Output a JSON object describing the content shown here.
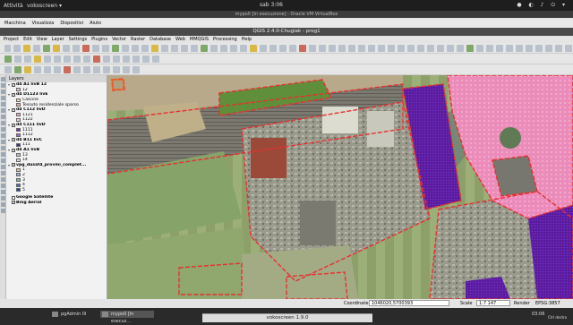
{
  "top_bar": {
    "activities": "Attività",
    "app": "vokoscreen ▾",
    "clock": "sab 3:06",
    "tray": "● ◐ ♪ ⏻ ▾"
  },
  "vbox": {
    "title": "mypo0 [In esecuzione] - Oracle VM VirtualBox",
    "menu": [
      "Macchina",
      "Visualizza",
      "Dispositivi",
      "Aiuto"
    ]
  },
  "qgis": {
    "title": "QGIS 2.4.0-Chugiak - prog1",
    "menu": [
      "Project",
      "Edit",
      "View",
      "Layer",
      "Settings",
      "Plugins",
      "Vector",
      "Raster",
      "Database",
      "Web",
      "MMQGIS",
      "Processing",
      "Help"
    ]
  },
  "layers_panel": {
    "title": "Layers",
    "items": [
      {
        "label": "d4 A1 livB 12",
        "bold": true,
        "indent": 0,
        "checked": true,
        "twisty": "▾"
      },
      {
        "label": "12",
        "bold": false,
        "indent": 1,
        "swatch": "#e8c9c0"
      },
      {
        "label": "d4 D1123 livE",
        "bold": true,
        "indent": 0,
        "checked": true,
        "twisty": "▾"
      },
      {
        "label": "Cascine",
        "bold": false,
        "indent": 1,
        "swatch": "#f2d9a0"
      },
      {
        "label": "Tessuto residenziale sparso",
        "bold": false,
        "indent": 1,
        "swatch": "#f0a8a0"
      },
      {
        "label": "d4 C112 livD",
        "bold": true,
        "indent": 0,
        "checked": true,
        "twisty": "▾"
      },
      {
        "label": "1121",
        "bold": false,
        "indent": 1,
        "swatch": "#f1a4c4"
      },
      {
        "label": "1122",
        "bold": false,
        "indent": 1,
        "swatch": "#f7c6da"
      },
      {
        "label": "d4 C111 livD",
        "bold": true,
        "indent": 0,
        "checked": true,
        "twisty": "▾"
      },
      {
        "label": "1111",
        "bold": false,
        "indent": 1,
        "swatch": "#7b2bb0"
      },
      {
        "label": "1112",
        "bold": false,
        "indent": 1,
        "swatch": "#a06ad0"
      },
      {
        "label": "d4 B11 livC",
        "bold": true,
        "indent": 0,
        "checked": true,
        "twisty": "▾"
      },
      {
        "label": "111",
        "bold": false,
        "indent": 1,
        "swatch": "#4a2a8a"
      },
      {
        "label": "d4 A1 livB",
        "bold": true,
        "indent": 0,
        "checked": true,
        "twisty": "▾"
      },
      {
        "label": "13",
        "bold": false,
        "indent": 1,
        "swatch": "#c0c0d0"
      },
      {
        "label": "14",
        "bold": false,
        "indent": 1,
        "swatch": "#d8d8d8"
      },
      {
        "label": "vpg_dusaf4_provmi_complet...",
        "bold": true,
        "indent": 0,
        "checked": true,
        "twisty": "▾"
      },
      {
        "label": "1",
        "bold": false,
        "indent": 1,
        "swatch": "#f0c080"
      },
      {
        "label": "2",
        "bold": false,
        "indent": 1,
        "swatch": "#90b0e0"
      },
      {
        "label": "3",
        "bold": false,
        "indent": 1,
        "swatch": "#70c0a0"
      },
      {
        "label": "4",
        "bold": false,
        "indent": 1,
        "swatch": "#4070c0"
      },
      {
        "label": "5",
        "bold": false,
        "indent": 1,
        "swatch": "#2040a0"
      },
      {
        "label": "",
        "bold": false,
        "indent": 0,
        "spacer": true
      },
      {
        "label": "Google Satellite",
        "bold": true,
        "indent": 0,
        "checked": false,
        "twisty": ""
      },
      {
        "label": "Bing Aerial",
        "bold": true,
        "indent": 0,
        "checked": true,
        "twisty": ""
      }
    ]
  },
  "status_bar": {
    "coordinate_label": "Coordinate:",
    "coordinate_value": "1046020,5700393",
    "scale_label": "Scale",
    "scale_value": "1:7 147",
    "render_label": "Render",
    "crs": "EPSG:3857"
  },
  "taskbar": {
    "items": [
      {
        "label": "pgAdmin III"
      },
      {
        "label": "mypo0 [In esecuz..."
      },
      {
        "label": "vokoscreen"
      }
    ],
    "clock": "03:06",
    "keyboard": "Ctrl destro"
  },
  "voko_dialog": {
    "title": "vokoscreen 1.9.0"
  },
  "colors": {
    "boundary": "#e63030",
    "pink": "#ff7fb2",
    "purple": "#5b1ca0",
    "grass": "#5f8f3a"
  }
}
